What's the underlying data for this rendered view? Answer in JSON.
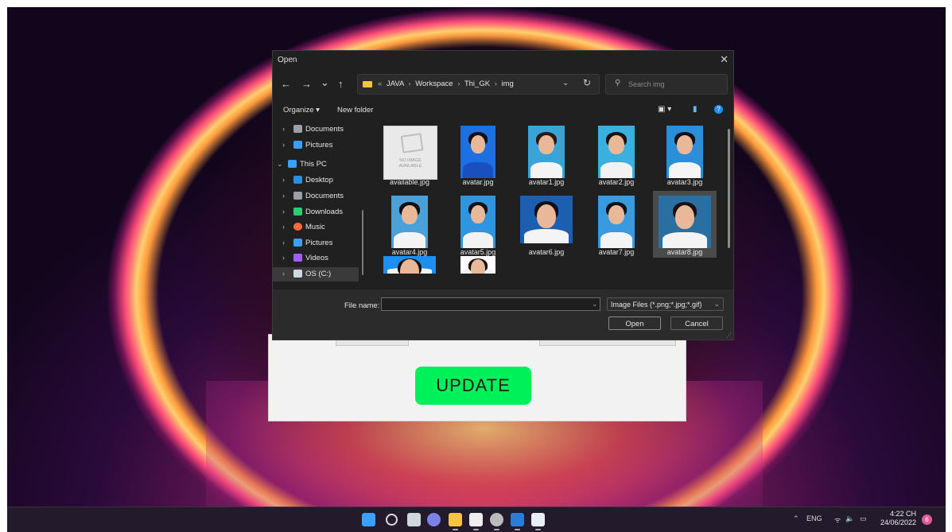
{
  "app": {
    "update_label": "UPDATE"
  },
  "dialog": {
    "title": "Open",
    "close_glyph": "✕",
    "nav": {
      "back": "←",
      "forward": "→",
      "recent": "⌄",
      "up": "↑"
    },
    "address": {
      "crumbs": [
        "JAVA",
        "Workspace",
        "Thi_GK",
        "img"
      ],
      "lead": "«",
      "separator": "›",
      "dropdown": "⌄",
      "refresh": "↻"
    },
    "search": {
      "placeholder": "Search img",
      "icon": "⚲"
    },
    "toolbar": {
      "organize": "Organize ▾",
      "new_folder": "New folder",
      "view_glyph": "▣ ▾",
      "pane_glyph": "▮",
      "help_glyph": "?"
    },
    "nav_pane": [
      {
        "label": "Documents",
        "icon": "documents-icon",
        "color": "#9aa0a6",
        "chevron": "›"
      },
      {
        "label": "Pictures",
        "icon": "pictures-icon",
        "color": "#3aa0ff",
        "chevron": "›"
      },
      {
        "label": "This PC",
        "icon": "computer-icon",
        "color": "#3aa0ff",
        "chevron": "⌄"
      },
      {
        "label": "Desktop",
        "icon": "desktop-icon",
        "color": "#2a8fe0",
        "chevron": "›"
      },
      {
        "label": "Documents",
        "icon": "documents-icon",
        "color": "#9aa0a6",
        "chevron": "›"
      },
      {
        "label": "Downloads",
        "icon": "downloads-icon",
        "color": "#2ecc71",
        "chevron": "›"
      },
      {
        "label": "Music",
        "icon": "music-icon",
        "color": "#ff6a3d",
        "chevron": "›"
      },
      {
        "label": "Pictures",
        "icon": "pictures-icon",
        "color": "#3aa0ff",
        "chevron": "›"
      },
      {
        "label": "Videos",
        "icon": "videos-icon",
        "color": "#a45cff",
        "chevron": "›"
      },
      {
        "label": "OS (C:)",
        "icon": "drive-icon",
        "color": "#cfd8dc",
        "chevron": "›"
      }
    ],
    "files": [
      {
        "name": "available.jpg",
        "kind": "noimage",
        "noimage_text": "NO IMAGE\nAVAILABLE"
      },
      {
        "name": "avatar.jpg",
        "kind": "photo",
        "bg": "#1e6fe0",
        "hair": "#111",
        "body": "#1a4fbf"
      },
      {
        "name": "avatar1.jpg",
        "kind": "photo",
        "bg": "#3aa3d8",
        "hair": "#2a1a12",
        "body": "#f4f4f4"
      },
      {
        "name": "avatar2.jpg",
        "kind": "photo",
        "bg": "#3ab0e0",
        "hair": "#1a1010",
        "body": "#f2f2f2"
      },
      {
        "name": "avatar3.jpg",
        "kind": "photo",
        "bg": "#2a8fd8",
        "hair": "#111",
        "body": "#f5f5f5"
      },
      {
        "name": "avatar4.jpg",
        "kind": "photo",
        "bg": "#4aa0d8",
        "hair": "#111",
        "body": "#f4f4f4"
      },
      {
        "name": "avatar5.jpg",
        "kind": "photo",
        "bg": "#2f95e0",
        "hair": "#111",
        "body": "#f2f2f2"
      },
      {
        "name": "avatar6.jpg",
        "kind": "photo",
        "bg": "#1c5fb0",
        "hair": "#111",
        "body": "#f4f4f4"
      },
      {
        "name": "avatar7.jpg",
        "kind": "photo",
        "bg": "#3a9ae0",
        "hair": "#111",
        "body": "#f4f4f4"
      },
      {
        "name": "avatar8.jpg",
        "kind": "photo",
        "bg": "#2a6fa0",
        "hair": "#1a1010",
        "body": "#f4f4f4",
        "selected": true
      },
      {
        "name": "",
        "kind": "photo",
        "bg": "#1d8ff0",
        "hair": "#1a1010",
        "body": "#f4f4f4"
      },
      {
        "name": "",
        "kind": "photo",
        "bg": "#ffffff",
        "hair": "#111",
        "body": "#f4f4f4"
      }
    ],
    "footer": {
      "file_name_label": "File name:",
      "file_name_value": "",
      "file_name_dropdown": "⌄",
      "file_type": "Image Files (*.png;*.jpg;*.gif)",
      "file_type_dropdown": "⌄",
      "open_label": "Open",
      "cancel_label": "Cancel",
      "grip": "⋰"
    }
  },
  "taskbar": {
    "apps": [
      {
        "name": "windows-start",
        "color": "#3aa0ff"
      },
      {
        "name": "search",
        "color": "#dddddd"
      },
      {
        "name": "task-view",
        "color": "#cfd8dc"
      },
      {
        "name": "chat",
        "color": "#7b83eb"
      },
      {
        "name": "file-explorer",
        "color": "#f5c542"
      },
      {
        "name": "notepad",
        "color": "#eeeeee"
      },
      {
        "name": "settings",
        "color": "#bbbbbb"
      },
      {
        "name": "word",
        "color": "#2b7cd3"
      },
      {
        "name": "java",
        "color": "#e8eef6"
      }
    ],
    "tray": {
      "chevron": "⌃",
      "lang": "ENG",
      "wifi": "ᯤ",
      "sound": "🔈",
      "battery": "▭",
      "time": "4:22 CH",
      "date": "24/06/2022",
      "notifications": "6"
    }
  }
}
